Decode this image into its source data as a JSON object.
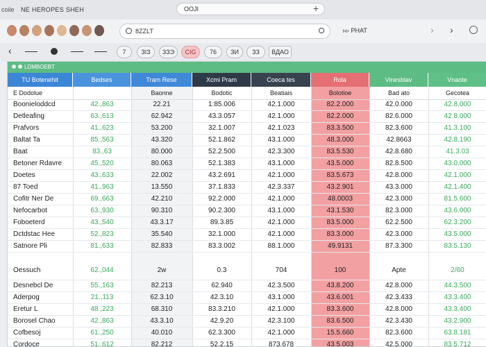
{
  "topbar": {
    "left_label": "coile",
    "title": "NE HEROPES SHEH",
    "tab_text": "OOJI",
    "tab_plus": "+"
  },
  "toolbar": {
    "avatar_colors": [
      "#c98a6a",
      "#b68264",
      "#d2a27c",
      "#a9735a",
      "#e0b794",
      "#8f6a58",
      "#c59575",
      "#6f5a52"
    ],
    "search_value": "8ZZLT",
    "path_label": "PHAT",
    "fwd": "›",
    "next": "›"
  },
  "filterbar": {
    "back": "‹",
    "chips": [
      {
        "label": "7"
      },
      {
        "label": "ЗІЗ"
      },
      {
        "label": "ЗЗЭ"
      },
      {
        "label": "CIG"
      },
      {
        "label": "76"
      },
      {
        "label": "ЗИ"
      },
      {
        "label": "ЗЗ"
      },
      {
        "label": "ВДАО"
      }
    ]
  },
  "window": {
    "title": "LDMBOEBT"
  },
  "columns": [
    {
      "header": "TU Botenehit",
      "sub": "E Dodolue"
    },
    {
      "header": "Bedses",
      "sub": ""
    },
    {
      "header": "Tram Rese",
      "sub": "Baonne"
    },
    {
      "header": "Xcmi Pram",
      "sub": "Bodotic"
    },
    {
      "header": "Coeca tes",
      "sub": "Beatiais"
    },
    {
      "header": "Rola",
      "sub": "Bolotioe"
    },
    {
      "header": "Vinesblav",
      "sub": "Bad ato"
    },
    {
      "header": "Vnaote",
      "sub": "Gecotea"
    }
  ],
  "rows": [
    [
      "Boonieloddcd",
      "42.,863",
      "22.21",
      "1:85.006",
      "42.1.000",
      "82.2.000",
      "42.0.000",
      "42.8.000"
    ],
    [
      "Detleafing",
      "63.,613",
      "62.942",
      "43.3.057",
      "42.1.000",
      "82.2.000",
      "82.6.000",
      "42.8.000"
    ],
    [
      "Prafvors",
      "41.,623",
      "53.200",
      "32.1.007",
      "42.1.023",
      "83.3.500",
      "82.3.600",
      "41.3.100"
    ],
    [
      "Baltat Ta",
      "85.,563",
      "43.320",
      "52.1.862",
      "43.1.000",
      "48.3.000",
      "42.8663",
      "42.8.190"
    ],
    [
      "Baat",
      "83.,63",
      "80.000",
      "52.2.500",
      "42.3.300",
      "83.5.530",
      "42.8.680",
      "41.3.03"
    ],
    [
      "Betoner Rdavre",
      "45.,520",
      "80.063",
      "52.1.383",
      "43.1.000",
      "43.5.000",
      "82.8.500",
      "43.0.000"
    ],
    [
      "Doetes",
      "43.,633",
      "22.002",
      "43.2.691",
      "42.1.000",
      "83.5.673",
      "42.8.000",
      "42.1.000"
    ],
    [
      "87 Toed",
      "41.,963",
      "13.550",
      "37.1.833",
      "42.3.337",
      "43.2.901",
      "43.3.000",
      "42.1.400"
    ],
    [
      "Cofitr Ner De",
      "69.,663",
      "42.210",
      "92.2.000",
      "42.1.000",
      "48.0003",
      "42.3.000",
      "81.5.600"
    ],
    [
      "Nefocarbot",
      "63.,930",
      "90.310",
      "90.2.300",
      "43.1.000",
      "43.1.530",
      "82.3.000",
      "43.6.000"
    ],
    [
      "Foboeterd",
      "43.,540",
      "43.3.17",
      "89.3.85",
      "42.1.000",
      "83.5.000",
      "62.2.500",
      "62.3.200"
    ],
    [
      "Dctdstac Hee",
      "52.,823",
      "35.540",
      "32.1.000",
      "42.1.000",
      "83.3.000",
      "42.3.000",
      "43.5.000"
    ],
    [
      "Satnore Pli",
      "81.,633",
      "82.833",
      "83.3.002",
      "88.1.000",
      "49.9131",
      "87.3.300",
      "83.5.130"
    ],
    [
      "Oessuch",
      "62.,044",
      "2w",
      "0.3",
      "704",
      "100",
      "Apte",
      "2/60"
    ],
    [
      "Desnebcl De",
      "55.,163",
      "82.213",
      "62.940",
      "42.3.500",
      "43.8.200",
      "42.8.000",
      "44.3.500"
    ],
    [
      "Aderpog",
      "21.,113",
      "62.3.10",
      "42.3.10",
      "43.1.000",
      "43.6.001",
      "42.3.433",
      "43.3.400"
    ],
    [
      "Eretur L",
      "48.,223",
      "68.310",
      "83.3.210",
      "42.1.000",
      "83.3.600",
      "42.8.000",
      "43.3.400"
    ],
    [
      "Borosel Chao",
      "42.,863",
      "43.3.10",
      "42.9.20",
      "42.3.100",
      "83.6.500",
      "42.3.430",
      "43.2.900"
    ],
    [
      "Cofbesoj",
      "61.,250",
      "40.010",
      "62.3.300",
      "42.1.000",
      "15.5.660",
      "82.3.600",
      "63.8.181"
    ],
    [
      "Cordoce",
      "51.,612",
      "82.212",
      "52.2.15",
      "873.678",
      "43.5.003",
      "42.5.000",
      "83.5.712"
    ]
  ]
}
